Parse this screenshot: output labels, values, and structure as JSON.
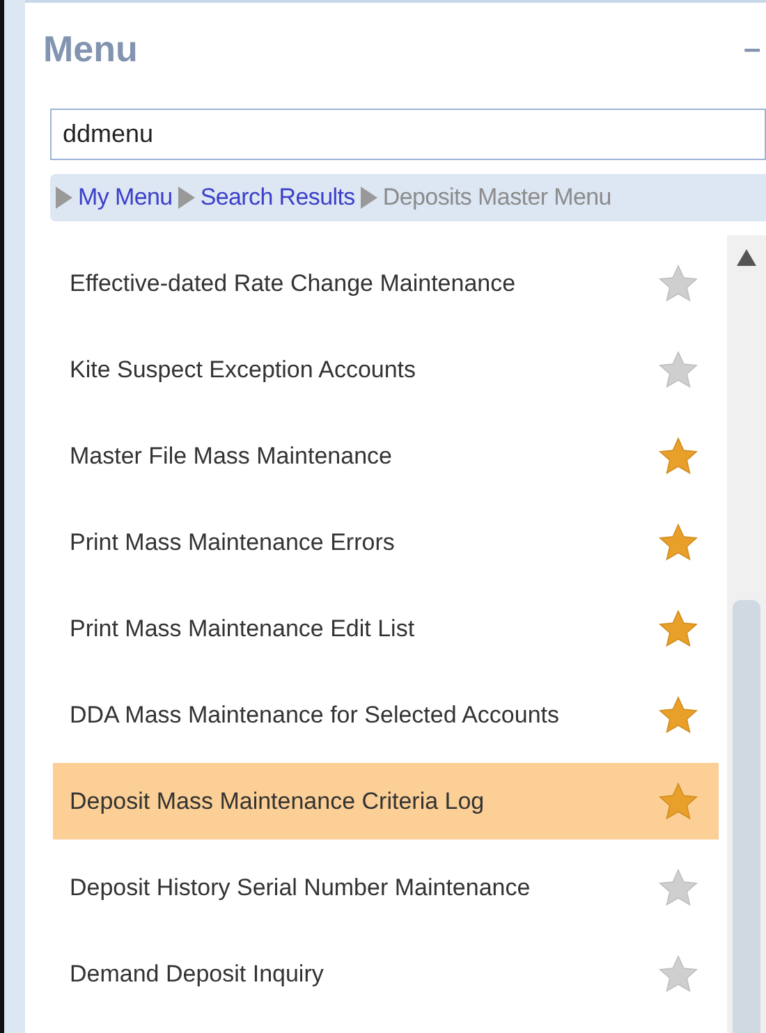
{
  "panel": {
    "title": "Menu",
    "collapse": "–"
  },
  "search": {
    "value": "ddmenu"
  },
  "breadcrumb": [
    {
      "label": "My Menu",
      "link": true
    },
    {
      "label": "Search Results",
      "link": true
    },
    {
      "label": "Deposits Master Menu",
      "link": false
    }
  ],
  "items": [
    {
      "label": "Effective-dated Rate Change Maintenance",
      "favorite": false,
      "selected": false
    },
    {
      "label": "Kite Suspect Exception Accounts",
      "favorite": false,
      "selected": false
    },
    {
      "label": "Master File Mass Maintenance",
      "favorite": true,
      "selected": false
    },
    {
      "label": "Print Mass Maintenance Errors",
      "favorite": true,
      "selected": false
    },
    {
      "label": "Print Mass Maintenance Edit List",
      "favorite": true,
      "selected": false
    },
    {
      "label": "DDA Mass Maintenance for Selected Accounts",
      "favorite": true,
      "selected": false
    },
    {
      "label": "Deposit Mass Maintenance Criteria Log",
      "favorite": true,
      "selected": true
    },
    {
      "label": "Deposit History Serial Number Maintenance",
      "favorite": false,
      "selected": false
    },
    {
      "label": "Demand Deposit Inquiry",
      "favorite": false,
      "selected": false
    }
  ]
}
